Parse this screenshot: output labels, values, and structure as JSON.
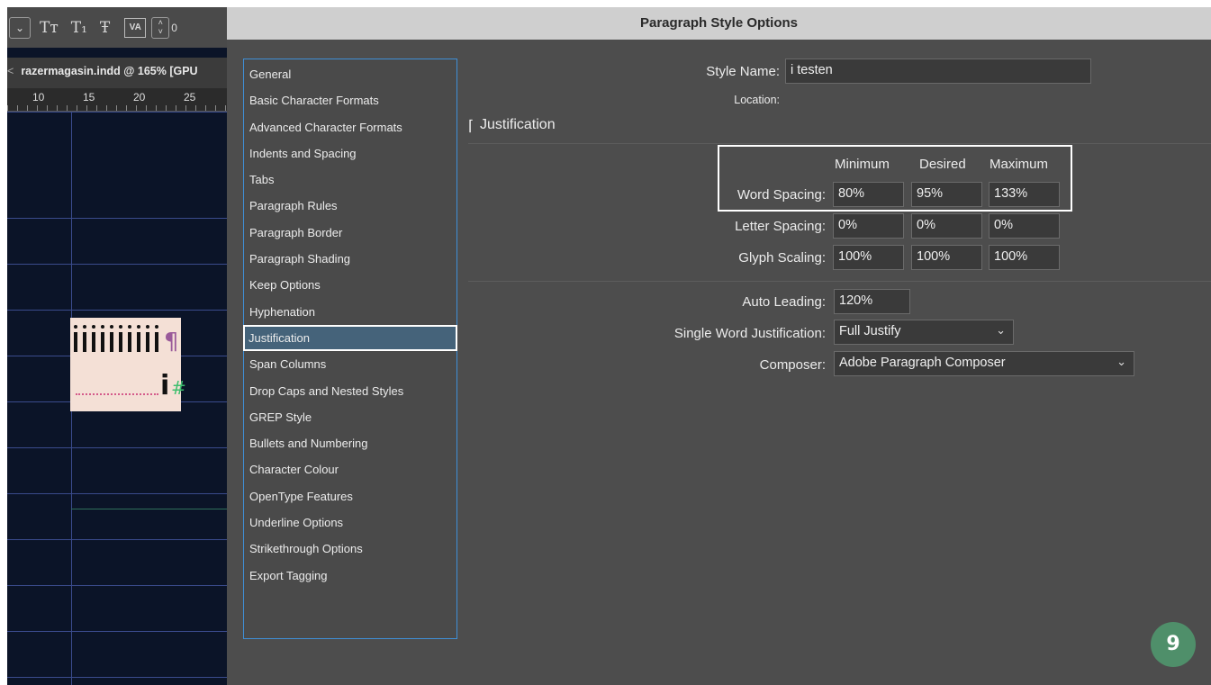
{
  "toolbar": {
    "stepper_value": "0",
    "glyphs": [
      "Tт",
      "T₁",
      "Ŧ"
    ],
    "va_label": "VA"
  },
  "document": {
    "tab_title": "razermagasin.indd @ 165% [GPU",
    "ruler_numbers": [
      "10",
      "15",
      "20",
      "25"
    ]
  },
  "dialog": {
    "title": "Paragraph Style Options",
    "nav_items": [
      "General",
      "Basic Character Formats",
      "Advanced Character Formats",
      "Indents and Spacing",
      "Tabs",
      "Paragraph Rules",
      "Paragraph Border",
      "Paragraph Shading",
      "Keep Options",
      "Hyphenation",
      "Justification",
      "Span Columns",
      "Drop Caps and Nested Styles",
      "GREP Style",
      "Bullets and Numbering",
      "Character Colour",
      "OpenType Features",
      "Underline Options",
      "Strikethrough Options",
      "Export Tagging"
    ],
    "selected_nav": "Justification",
    "style_name_label": "Style Name:",
    "style_name_value": "i testen",
    "location_label": "Location:",
    "section_title": "Justification",
    "columns": {
      "minimum": "Minimum",
      "desired": "Desired",
      "maximum": "Maximum"
    },
    "word_spacing": {
      "label": "Word Spacing:",
      "min": "80%",
      "desired": "95%",
      "max": "133%"
    },
    "letter_spacing": {
      "label": "Letter Spacing:",
      "min": "0%",
      "desired": "0%",
      "max": "0%"
    },
    "glyph_scaling": {
      "label": "Glyph Scaling:",
      "min": "100%",
      "desired": "100%",
      "max": "100%"
    },
    "auto_leading": {
      "label": "Auto Leading:",
      "value": "120%"
    },
    "single_word": {
      "label": "Single Word Justification:",
      "value": "Full Justify"
    },
    "composer": {
      "label": "Composer:",
      "value": "Adobe Paragraph Composer"
    }
  },
  "badge": "9",
  "colors": {
    "dialog_bg": "#4d4d4d",
    "nav_border": "#3f8fd6",
    "selected_bg": "#45637a",
    "badge_bg": "#4f8f6a",
    "canvas_bg": "#0b1428"
  }
}
